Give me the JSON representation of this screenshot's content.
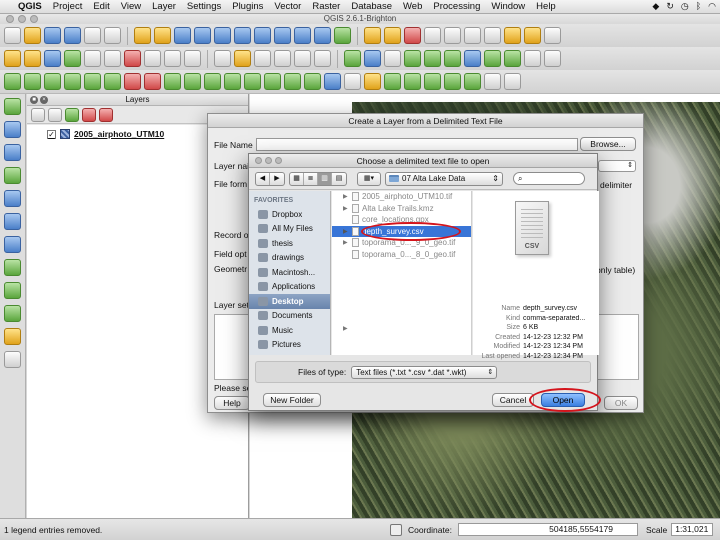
{
  "menubar": {
    "app": "QGIS",
    "items": [
      "Project",
      "Edit",
      "View",
      "Layer",
      "Settings",
      "Plugins",
      "Vector",
      "Raster",
      "Database",
      "Web",
      "Processing",
      "Window",
      "Help"
    ]
  },
  "window_title": "QGIS 2.6.1-Brighton",
  "layers_panel": {
    "title": "Layers",
    "layer_name": "2005_airphoto_UTM10",
    "checked_mark": "✓"
  },
  "create_dialog": {
    "title": "Create a Layer from a Delimited Text File",
    "file_name_label": "File Name",
    "browse_label": "Browse...",
    "layer_name_label": "Layer nai",
    "file_format_label": "File form",
    "record_label": "Record o",
    "field_label": "Field opt",
    "geometry_label": "Geometr",
    "layer_settings_label": "Layer set",
    "please_label": "Please se",
    "help_label": "Help",
    "ok_label": "OK",
    "delimiter_fragment": "delimiter",
    "only_table_fragment": "only table)",
    "ng_fragment": "ng",
    "g_fragment": "g"
  },
  "chooser": {
    "title": "Choose a delimited text file to open",
    "path": "07 Alta Lake Data",
    "favorites_header": "FAVORITES",
    "sidebar_items": [
      "Dropbox",
      "All My Files",
      "thesis",
      "drawings",
      "Macintosh...",
      "Applications",
      "Desktop",
      "Documents",
      "Music",
      "Pictures"
    ],
    "selected_sidebar": "Desktop",
    "files": [
      "2005_airphoto_UTM10.tif",
      "Alta Lake Trails.kmz",
      "core_locations.gpx",
      "depth_survey.csv",
      "toporama_0..._9_0_geo.tif",
      "toporama_0..._8_0_geo.tif"
    ],
    "selected_file": "depth_survey.csv",
    "preview": {
      "ext": "CSV",
      "meta": [
        {
          "k": "Name",
          "v": "depth_survey.csv"
        },
        {
          "k": "Kind",
          "v": "comma-separated..."
        },
        {
          "k": "Size",
          "v": "6 KB"
        },
        {
          "k": "Created",
          "v": "14-12-23 12:32 PM"
        },
        {
          "k": "Modified",
          "v": "14-12-23 12:34 PM"
        },
        {
          "k": "Last opened",
          "v": "14-12-23 12:34 PM"
        }
      ]
    },
    "files_of_type_label": "Files of type:",
    "files_of_type_value": "Text files (*.txt *.csv *.dat *.wkt)",
    "new_folder_label": "New Folder",
    "cancel_label": "Cancel",
    "open_label": "Open"
  },
  "status": {
    "message": "1 legend entries removed.",
    "coordinate_label": "Coordinate:",
    "coordinate_value": "504185,5554179",
    "scale_label": "Scale",
    "scale_value": "1:31,021"
  },
  "colors": {
    "highlight_circle": "#d4141c",
    "selection_blue": "#3875d7",
    "open_button_blue": "#3a7fe0"
  }
}
